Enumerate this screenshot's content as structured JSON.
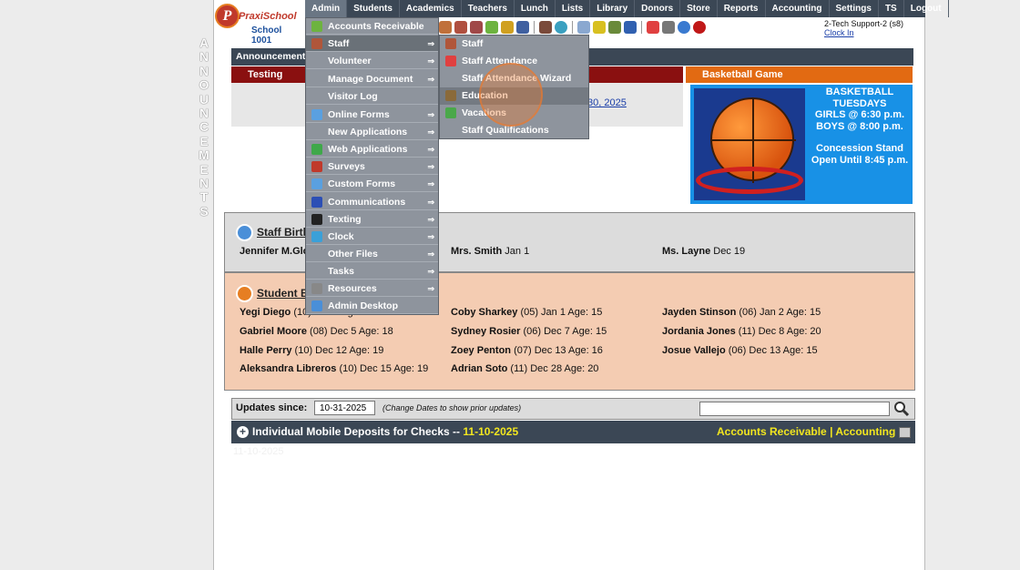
{
  "vertical_label": "ANNOUNCEMENTS",
  "logo": {
    "brand": "PraxiSchool",
    "mark": "P",
    "school": "School 1001"
  },
  "topnav": [
    "Admin",
    "Students",
    "Academics",
    "Teachers",
    "Lunch",
    "Lists",
    "Library",
    "Donors",
    "Store",
    "Reports",
    "Accounting",
    "Settings",
    "TS",
    "Logout"
  ],
  "user": {
    "name": "2-Tech Support-2 (s8)",
    "clock": "Clock In"
  },
  "announcements": {
    "title": "Announcements",
    "testing": {
      "title": "Testing",
      "link": "30, 2025"
    },
    "basketball": {
      "title": "Basketball Game",
      "lines": [
        "BASKETBALL",
        "TUESDAYS",
        "GIRLS @ 6:30 p.m.",
        "BOYS  @ 8:00 p.m.",
        "",
        "Concession Stand",
        "Open Until 8:45 p.m."
      ]
    }
  },
  "staff_birthdays": {
    "title": "Staff Birth",
    "items": [
      {
        "name": "Jennifer M.Glo",
        "info": ""
      },
      {
        "name": "Mrs. Smith",
        "info": "Jan 1"
      },
      {
        "name": "Ms. Layne",
        "info": "Dec 19"
      }
    ]
  },
  "student_birthdays": {
    "title": "Student B",
    "items": [
      {
        "name": "Yegi Diego",
        "info": "(10) Jan 1 Age: 19"
      },
      {
        "name": "Coby Sharkey",
        "info": "(05) Jan 1 Age: 15"
      },
      {
        "name": "Jayden Stinson",
        "info": "(06) Jan 2 Age: 15"
      },
      {
        "name": "Gabriel Moore",
        "info": "(08) Dec 5 Age: 18"
      },
      {
        "name": "Sydney Rosier",
        "info": "(06) Dec 7 Age: 15"
      },
      {
        "name": "Jordania Jones",
        "info": "(11) Dec 8 Age: 20"
      },
      {
        "name": "Halle Perry",
        "info": "(10) Dec 12 Age: 19"
      },
      {
        "name": "Zoey Penton",
        "info": "(07) Dec 13 Age: 16"
      },
      {
        "name": "Josue Vallejo",
        "info": "(06) Dec 13 Age: 15"
      },
      {
        "name": "Aleksandra Libreros",
        "info": "(10) Dec 15 Age: 19"
      },
      {
        "name": "Adrian Soto",
        "info": "(11) Dec 28 Age: 20"
      }
    ]
  },
  "updates": {
    "label": "Updates since:",
    "date": "10-31-2025",
    "note": "(Change Dates to show prior updates)",
    "deposit_title": "Individual Mobile Deposits for Checks",
    "deposit_sep": "--",
    "deposit_date": "11-10-2025",
    "link_ar": "Accounts Receivable",
    "link_sep": "|",
    "link_acc": "Accounting",
    "faded": "11-10-2025"
  },
  "admin_menu": [
    {
      "label": "Accounts Receivable",
      "arrow": "",
      "icon": "money-icon",
      "color": "#6db33f"
    },
    {
      "label": "Staff",
      "arrow": "⇒",
      "icon": "staff-icon",
      "color": "#b0563a",
      "active": true
    },
    {
      "label": "Volunteer",
      "arrow": "⇒",
      "icon": "",
      "color": ""
    },
    {
      "label": "Manage Document",
      "arrow": "⇒",
      "icon": "",
      "color": ""
    },
    {
      "label": "Visitor Log",
      "arrow": "",
      "icon": "",
      "color": ""
    },
    {
      "label": "Online Forms",
      "arrow": "⇒",
      "icon": "forms-icon",
      "color": "#5aa0e0"
    },
    {
      "label": "New Applications",
      "arrow": "⇒",
      "icon": "",
      "color": ""
    },
    {
      "label": "Web Applications",
      "arrow": "⇒",
      "icon": "globe-icon",
      "color": "#3fa84a"
    },
    {
      "label": "Surveys",
      "arrow": "⇒",
      "icon": "survey-icon",
      "color": "#c0392b"
    },
    {
      "label": "Custom Forms",
      "arrow": "⇒",
      "icon": "custom-forms-icon",
      "color": "#5aa0e0"
    },
    {
      "label": "Communications",
      "arrow": "⇒",
      "icon": "at-icon",
      "color": "#2c4fb5"
    },
    {
      "label": "Texting",
      "arrow": "⇒",
      "icon": "phone-icon",
      "color": "#222"
    },
    {
      "label": "Clock",
      "arrow": "⇒",
      "icon": "clock-icon",
      "color": "#3ba0d8"
    },
    {
      "label": "Other Files",
      "arrow": "⇒",
      "icon": "",
      "color": ""
    },
    {
      "label": "Tasks",
      "arrow": "⇒",
      "icon": "",
      "color": ""
    },
    {
      "label": "Resources",
      "arrow": "⇒",
      "icon": "resources-icon",
      "color": "#888"
    },
    {
      "label": "Admin Desktop",
      "arrow": "",
      "icon": "desktop-icon",
      "color": "#4a8fd8"
    }
  ],
  "staff_submenu": [
    {
      "label": "Staff",
      "icon": "staff-icon",
      "color": "#b0563a"
    },
    {
      "label": "Staff Attendance",
      "icon": "calendar-icon",
      "color": "#e04040"
    },
    {
      "label": "Staff Attendance Wizard",
      "icon": "",
      "color": ""
    },
    {
      "label": "Education",
      "icon": "education-icon",
      "color": "#8a6a3a",
      "active": true
    },
    {
      "label": "Vacations",
      "icon": "palm-icon",
      "color": "#4aa84a"
    },
    {
      "label": "Staff Qualifications",
      "icon": "",
      "color": ""
    }
  ]
}
